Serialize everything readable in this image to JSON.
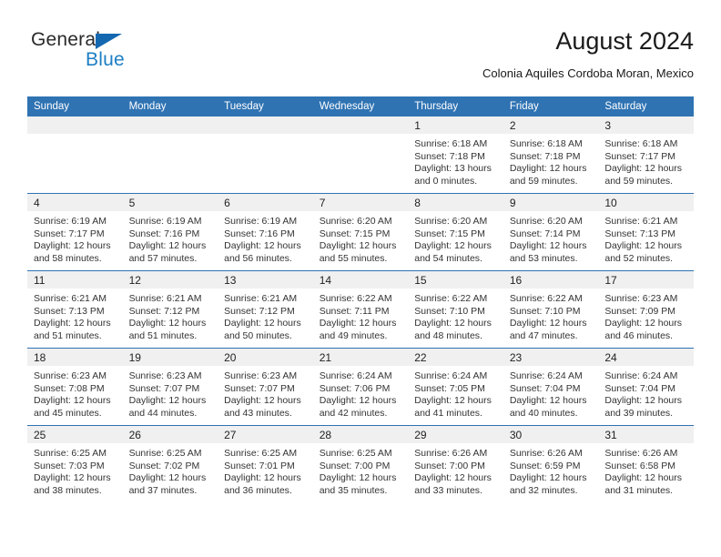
{
  "brand": {
    "name_top": "General",
    "name_bottom": "Blue",
    "triangle_color": "#1468b0",
    "blue_text_color": "#1d7ec4"
  },
  "header": {
    "title": "August 2024",
    "subtitle": "Colonia Aquiles Cordoba Moran, Mexico"
  },
  "theme": {
    "header_blue": "#2f73b3",
    "daynum_band": "#f0f0f0",
    "text": "#333333"
  },
  "weekday_headers": [
    "Sunday",
    "Monday",
    "Tuesday",
    "Wednesday",
    "Thursday",
    "Friday",
    "Saturday"
  ],
  "weeks": [
    [
      {
        "day": "",
        "empty": true
      },
      {
        "day": "",
        "empty": true
      },
      {
        "day": "",
        "empty": true
      },
      {
        "day": "",
        "empty": true
      },
      {
        "day": "1",
        "sunrise": "Sunrise: 6:18 AM",
        "sunset": "Sunset: 7:18 PM",
        "daylight_1": "Daylight: 13 hours",
        "daylight_2": "and 0 minutes."
      },
      {
        "day": "2",
        "sunrise": "Sunrise: 6:18 AM",
        "sunset": "Sunset: 7:18 PM",
        "daylight_1": "Daylight: 12 hours",
        "daylight_2": "and 59 minutes."
      },
      {
        "day": "3",
        "sunrise": "Sunrise: 6:18 AM",
        "sunset": "Sunset: 7:17 PM",
        "daylight_1": "Daylight: 12 hours",
        "daylight_2": "and 59 minutes."
      }
    ],
    [
      {
        "day": "4",
        "sunrise": "Sunrise: 6:19 AM",
        "sunset": "Sunset: 7:17 PM",
        "daylight_1": "Daylight: 12 hours",
        "daylight_2": "and 58 minutes."
      },
      {
        "day": "5",
        "sunrise": "Sunrise: 6:19 AM",
        "sunset": "Sunset: 7:16 PM",
        "daylight_1": "Daylight: 12 hours",
        "daylight_2": "and 57 minutes."
      },
      {
        "day": "6",
        "sunrise": "Sunrise: 6:19 AM",
        "sunset": "Sunset: 7:16 PM",
        "daylight_1": "Daylight: 12 hours",
        "daylight_2": "and 56 minutes."
      },
      {
        "day": "7",
        "sunrise": "Sunrise: 6:20 AM",
        "sunset": "Sunset: 7:15 PM",
        "daylight_1": "Daylight: 12 hours",
        "daylight_2": "and 55 minutes."
      },
      {
        "day": "8",
        "sunrise": "Sunrise: 6:20 AM",
        "sunset": "Sunset: 7:15 PM",
        "daylight_1": "Daylight: 12 hours",
        "daylight_2": "and 54 minutes."
      },
      {
        "day": "9",
        "sunrise": "Sunrise: 6:20 AM",
        "sunset": "Sunset: 7:14 PM",
        "daylight_1": "Daylight: 12 hours",
        "daylight_2": "and 53 minutes."
      },
      {
        "day": "10",
        "sunrise": "Sunrise: 6:21 AM",
        "sunset": "Sunset: 7:13 PM",
        "daylight_1": "Daylight: 12 hours",
        "daylight_2": "and 52 minutes."
      }
    ],
    [
      {
        "day": "11",
        "sunrise": "Sunrise: 6:21 AM",
        "sunset": "Sunset: 7:13 PM",
        "daylight_1": "Daylight: 12 hours",
        "daylight_2": "and 51 minutes."
      },
      {
        "day": "12",
        "sunrise": "Sunrise: 6:21 AM",
        "sunset": "Sunset: 7:12 PM",
        "daylight_1": "Daylight: 12 hours",
        "daylight_2": "and 51 minutes."
      },
      {
        "day": "13",
        "sunrise": "Sunrise: 6:21 AM",
        "sunset": "Sunset: 7:12 PM",
        "daylight_1": "Daylight: 12 hours",
        "daylight_2": "and 50 minutes."
      },
      {
        "day": "14",
        "sunrise": "Sunrise: 6:22 AM",
        "sunset": "Sunset: 7:11 PM",
        "daylight_1": "Daylight: 12 hours",
        "daylight_2": "and 49 minutes."
      },
      {
        "day": "15",
        "sunrise": "Sunrise: 6:22 AM",
        "sunset": "Sunset: 7:10 PM",
        "daylight_1": "Daylight: 12 hours",
        "daylight_2": "and 48 minutes."
      },
      {
        "day": "16",
        "sunrise": "Sunrise: 6:22 AM",
        "sunset": "Sunset: 7:10 PM",
        "daylight_1": "Daylight: 12 hours",
        "daylight_2": "and 47 minutes."
      },
      {
        "day": "17",
        "sunrise": "Sunrise: 6:23 AM",
        "sunset": "Sunset: 7:09 PM",
        "daylight_1": "Daylight: 12 hours",
        "daylight_2": "and 46 minutes."
      }
    ],
    [
      {
        "day": "18",
        "sunrise": "Sunrise: 6:23 AM",
        "sunset": "Sunset: 7:08 PM",
        "daylight_1": "Daylight: 12 hours",
        "daylight_2": "and 45 minutes."
      },
      {
        "day": "19",
        "sunrise": "Sunrise: 6:23 AM",
        "sunset": "Sunset: 7:07 PM",
        "daylight_1": "Daylight: 12 hours",
        "daylight_2": "and 44 minutes."
      },
      {
        "day": "20",
        "sunrise": "Sunrise: 6:23 AM",
        "sunset": "Sunset: 7:07 PM",
        "daylight_1": "Daylight: 12 hours",
        "daylight_2": "and 43 minutes."
      },
      {
        "day": "21",
        "sunrise": "Sunrise: 6:24 AM",
        "sunset": "Sunset: 7:06 PM",
        "daylight_1": "Daylight: 12 hours",
        "daylight_2": "and 42 minutes."
      },
      {
        "day": "22",
        "sunrise": "Sunrise: 6:24 AM",
        "sunset": "Sunset: 7:05 PM",
        "daylight_1": "Daylight: 12 hours",
        "daylight_2": "and 41 minutes."
      },
      {
        "day": "23",
        "sunrise": "Sunrise: 6:24 AM",
        "sunset": "Sunset: 7:04 PM",
        "daylight_1": "Daylight: 12 hours",
        "daylight_2": "and 40 minutes."
      },
      {
        "day": "24",
        "sunrise": "Sunrise: 6:24 AM",
        "sunset": "Sunset: 7:04 PM",
        "daylight_1": "Daylight: 12 hours",
        "daylight_2": "and 39 minutes."
      }
    ],
    [
      {
        "day": "25",
        "sunrise": "Sunrise: 6:25 AM",
        "sunset": "Sunset: 7:03 PM",
        "daylight_1": "Daylight: 12 hours",
        "daylight_2": "and 38 minutes."
      },
      {
        "day": "26",
        "sunrise": "Sunrise: 6:25 AM",
        "sunset": "Sunset: 7:02 PM",
        "daylight_1": "Daylight: 12 hours",
        "daylight_2": "and 37 minutes."
      },
      {
        "day": "27",
        "sunrise": "Sunrise: 6:25 AM",
        "sunset": "Sunset: 7:01 PM",
        "daylight_1": "Daylight: 12 hours",
        "daylight_2": "and 36 minutes."
      },
      {
        "day": "28",
        "sunrise": "Sunrise: 6:25 AM",
        "sunset": "Sunset: 7:00 PM",
        "daylight_1": "Daylight: 12 hours",
        "daylight_2": "and 35 minutes."
      },
      {
        "day": "29",
        "sunrise": "Sunrise: 6:26 AM",
        "sunset": "Sunset: 7:00 PM",
        "daylight_1": "Daylight: 12 hours",
        "daylight_2": "and 33 minutes."
      },
      {
        "day": "30",
        "sunrise": "Sunrise: 6:26 AM",
        "sunset": "Sunset: 6:59 PM",
        "daylight_1": "Daylight: 12 hours",
        "daylight_2": "and 32 minutes."
      },
      {
        "day": "31",
        "sunrise": "Sunrise: 6:26 AM",
        "sunset": "Sunset: 6:58 PM",
        "daylight_1": "Daylight: 12 hours",
        "daylight_2": "and 31 minutes."
      }
    ]
  ]
}
